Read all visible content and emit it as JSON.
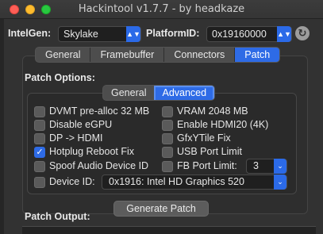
{
  "window": {
    "title": "Hackintool v1.7.7 - by headkaze"
  },
  "selectors": {
    "intelgen_label": "IntelGen:",
    "intelgen_value": "Skylake",
    "platformid_label": "PlatformID:",
    "platformid_value": "0x19160000",
    "refresh_icon": "refresh-icon"
  },
  "main_tabs": [
    {
      "label": "General",
      "active": false
    },
    {
      "label": "Framebuffer",
      "active": false
    },
    {
      "label": "Connectors",
      "active": false
    },
    {
      "label": "Patch",
      "active": true
    }
  ],
  "patch_options": {
    "heading": "Patch Options:",
    "subtabs": [
      {
        "label": "General",
        "active": false
      },
      {
        "label": "Advanced",
        "active": true
      }
    ],
    "left_column": [
      {
        "label": "DVMT pre-alloc 32 MB",
        "checked": false
      },
      {
        "label": "Disable eGPU",
        "checked": false
      },
      {
        "label": "DP -> HDMI",
        "checked": false
      },
      {
        "label": "Hotplug Reboot Fix",
        "checked": true
      },
      {
        "label": "Spoof Audio Device ID",
        "checked": false
      },
      {
        "label": "Device ID:",
        "checked": false
      }
    ],
    "right_column": [
      {
        "label": "VRAM 2048 MB",
        "checked": false
      },
      {
        "label": "Enable HDMI20 (4K)",
        "checked": false
      },
      {
        "label": "GfxYTile Fix",
        "checked": false
      },
      {
        "label": "USB Port Limit",
        "checked": false
      },
      {
        "label": "FB Port Limit:",
        "checked": false
      }
    ],
    "fb_port_limit_value": "3",
    "device_id_value": "0x1916: Intel HD Graphics 520"
  },
  "generate_button": "Generate Patch",
  "patch_output_heading": "Patch Output:",
  "colors": {
    "accent": "#2e6be6",
    "window_bg": "#323232"
  }
}
